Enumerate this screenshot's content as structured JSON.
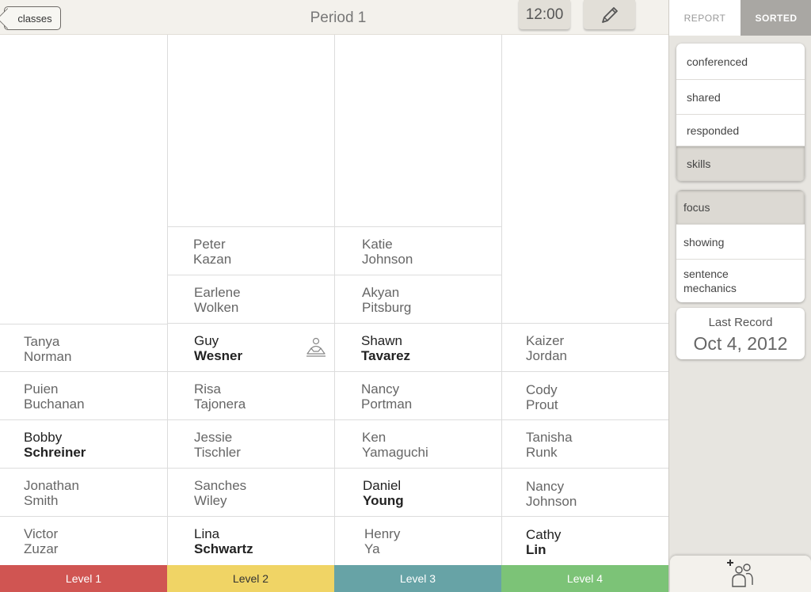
{
  "header": {
    "back_label": "classes",
    "title": "Period 1",
    "time": "12:00",
    "edit_icon": "pencil-icon"
  },
  "levels": [
    {
      "label": "Level 1",
      "color": "#d05552"
    },
    {
      "label": "Level 2",
      "color": "#f0d465"
    },
    {
      "label": "Level 3",
      "color": "#67a3a6"
    },
    {
      "label": "Level 4",
      "color": "#7cc377"
    }
  ],
  "columns": [
    {
      "students": [
        {
          "first": "Tanya",
          "last": "Norman",
          "bold": false
        },
        {
          "first": "Puien",
          "last": "Buchanan",
          "bold": false
        },
        {
          "first": "Bobby",
          "last": "Schreiner",
          "bold": true
        },
        {
          "first": "Jonathan",
          "last": "Smith",
          "bold": false
        },
        {
          "first": "Victor",
          "last": "Zuzar",
          "bold": false
        }
      ]
    },
    {
      "students": [
        {
          "first": "Peter",
          "last": "Kazan",
          "bold": false
        },
        {
          "first": "Earlene",
          "last": "Wolken",
          "bold": false
        },
        {
          "first": "Guy",
          "last": "Wesner",
          "bold": true,
          "icon": "conference-icon"
        },
        {
          "first": "Risa",
          "last": "Tajonera",
          "bold": false
        },
        {
          "first": "Jessie",
          "last": "Tischler",
          "bold": false
        },
        {
          "first": "Sanches",
          "last": "Wiley",
          "bold": false
        },
        {
          "first": "Lina",
          "last": "Schwartz",
          "bold": true
        }
      ]
    },
    {
      "students": [
        {
          "first": "Katie",
          "last": "Johnson",
          "bold": false
        },
        {
          "first": "Akyan",
          "last": "Pitsburg",
          "bold": false
        },
        {
          "first": "Shawn",
          "last": "Tavarez",
          "bold": true
        },
        {
          "first": "Nancy",
          "last": "Portman",
          "bold": false
        },
        {
          "first": "Ken",
          "last": "Yamaguchi",
          "bold": false
        },
        {
          "first": "Daniel",
          "last": "Young",
          "bold": true
        },
        {
          "first": "Henry",
          "last": "Ya",
          "bold": false
        }
      ]
    },
    {
      "students": [
        {
          "first": "Kaizer",
          "last": "Jordan",
          "bold": false
        },
        {
          "first": "Cody",
          "last": "Prout",
          "bold": false
        },
        {
          "first": "Tanisha",
          "last": "Runk",
          "bold": false
        },
        {
          "first": "Nancy",
          "last": "Johnson",
          "bold": false
        },
        {
          "first": "Cathy",
          "last": "Lin",
          "bold": true
        }
      ]
    }
  ],
  "sidebar": {
    "tabs": [
      {
        "label": "REPORT",
        "active": false
      },
      {
        "label": "SORTED",
        "active": true
      }
    ],
    "group1": [
      {
        "label": "conferenced",
        "selected": false
      },
      {
        "label": "shared",
        "selected": false
      },
      {
        "label": "responded",
        "selected": false
      },
      {
        "label": "skills",
        "selected": true
      }
    ],
    "group2": [
      {
        "label": "focus",
        "selected": true
      },
      {
        "label": "showing",
        "selected": false
      },
      {
        "label": "sentence mechanics",
        "selected": false
      }
    ],
    "last_record": {
      "label": "Last Record",
      "date": "Oct 4, 2012"
    },
    "add_icon": "add-student-icon"
  }
}
